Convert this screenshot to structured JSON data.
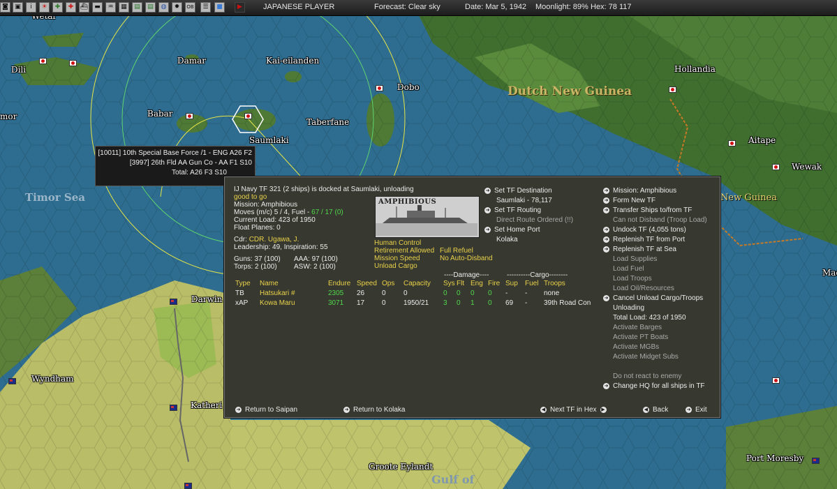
{
  "topbar": {
    "player": "JAPANESE PLAYER",
    "forecast": "Forecast: Clear sky",
    "date": "Date: Mar 5, 1942",
    "moonlight": "Moonlight: 89%",
    "hex": "Hex: 78 117",
    "buttons": [
      "map-icon",
      "disk-icon",
      "info-icon",
      "rising-sun-icon",
      "plane-icon",
      "red-plane-icon",
      "ship-icon",
      "sub-icon",
      "hq-icon",
      "base-icon",
      "report-icon",
      "globe-icon",
      "gear-icon",
      "ob-icon",
      "list-icon",
      "sky-icon",
      "play-icon"
    ],
    "button_glyphs": [
      "◙",
      "▣",
      "i",
      "☀",
      "✚",
      "✚",
      "⛴",
      "▬",
      "♒",
      "▦",
      "▤",
      "◍",
      "✹",
      "OB",
      "☰",
      "■",
      "▶"
    ]
  },
  "map_labels": {
    "wetar": "Wetar",
    "dili": "Dili",
    "timor_partial": "mor",
    "damar": "Damar",
    "kai": "Kai-eilanden",
    "hollandia": "Hollandia",
    "dobo": "Dobo",
    "dutch_ng": "Dutch New Guinea",
    "babar": "Babar",
    "taberfane": "Taberfane",
    "saumlaki": "Saumlaki",
    "aitape": "Aitape",
    "wewak": "Wewak",
    "timor_sea": "Timor Sea",
    "new_guinea": "New Guinea",
    "darwin": "Darwin",
    "wyndham": "Wyndham",
    "katherine": "Katheri",
    "groote": "Groote Eylandt",
    "gulf": "Gulf of",
    "port_moresby": "Port Moresby",
    "mac": "Mac"
  },
  "tooltip": {
    "line1": "[10011] 10th Special Base Force /1 - ENG   A26  F2",
    "line2": "[3997] 26th Fld AA Gun Co - AA   F1  S10",
    "line3": "Total:  A26  F3  S10"
  },
  "panel": {
    "header": "IJ Navy TF 321 (2 ships) is docked at Saumlaki, unloading",
    "status": "good to go",
    "mission": "Mission: Amphibious",
    "moves_prefix": "Moves (m/c)  5 / 4, Fuel - ",
    "fuel": "67 / 17 (0)",
    "current_load": "Current Load:  423 of 1950",
    "float_planes": "Float Planes: 0",
    "cdr_label": "Cdr:",
    "cdr_name": "CDR. Ugawa, J.",
    "leadership": "Leadership: 49, Inspiration: 55",
    "guns": "Guns: 37 (100)",
    "aaa": "AAA: 97 (100)",
    "torps": "Torps: 2 (100)",
    "asw": "ASW: 2 (100)",
    "photo_title": "AMPHIBIOUS",
    "human_control": "Human Control",
    "retirement": "Retirement Allowed",
    "full_refuel": "Full Refuel",
    "mission_speed": "Mission Speed",
    "no_auto_disband": "No Auto-Disband",
    "unload_cargo": "Unload Cargo",
    "set_dest": "Set TF Destination",
    "dest_value": "Saumlaki - 78,117",
    "set_routing": "Set TF Routing",
    "direct_route": "Direct Route Ordered (!!)",
    "set_home": "Set Home Port",
    "home_value": "Kolaka",
    "right_menu": [
      {
        "label": "Mission: Amphibious",
        "arrow": true,
        "dim": false
      },
      {
        "label": "Form New TF",
        "arrow": true,
        "dim": false
      },
      {
        "label": "Transfer Ships to/from TF",
        "arrow": true,
        "dim": false
      },
      {
        "label": "Can not Disband (Troop Load)",
        "arrow": false,
        "dim": true
      },
      {
        "label": "Undock TF (4,055 tons)",
        "arrow": true,
        "dim": false
      },
      {
        "label": "Replenish TF from Port",
        "arrow": true,
        "dim": false
      },
      {
        "label": "Replenish TF at Sea",
        "arrow": true,
        "dim": false
      },
      {
        "label": "Load Supplies",
        "arrow": false,
        "dim": true
      },
      {
        "label": "Load Fuel",
        "arrow": false,
        "dim": true
      },
      {
        "label": "Load Troops",
        "arrow": false,
        "dim": true
      },
      {
        "label": "Load Oil/Resources",
        "arrow": false,
        "dim": true
      },
      {
        "label": "Cancel Unload Cargo/Troops",
        "arrow": true,
        "dim": false
      },
      {
        "label": "Unloading",
        "arrow": false,
        "dim": false
      },
      {
        "label": "Total Load: 423 of 1950",
        "arrow": false,
        "dim": false
      },
      {
        "label": "Activate Barges",
        "arrow": false,
        "dim": true
      },
      {
        "label": "Activate PT Boats",
        "arrow": false,
        "dim": true
      },
      {
        "label": "Activate MGBs",
        "arrow": false,
        "dim": true
      },
      {
        "label": "Activate Midget Subs",
        "arrow": false,
        "dim": true
      },
      {
        "label": "",
        "arrow": false,
        "dim": false
      },
      {
        "label": "Do not react to enemy",
        "arrow": false,
        "dim": true
      },
      {
        "label": "Change HQ for all ships in TF",
        "arrow": true,
        "dim": false
      }
    ],
    "group_damage": "----Damage----",
    "group_cargo": "----------Cargo--------",
    "columns": [
      "Type",
      "Name",
      "Endure",
      "Speed",
      "Ops",
      "Capacity",
      "Sys",
      "Flt",
      "Eng",
      "Fire",
      "Sup",
      "Fuel",
      "Troops"
    ],
    "rows": [
      [
        "TB",
        "Hatsukari #",
        "2305",
        "26",
        "0",
        "0",
        "0",
        "0",
        "0",
        "0",
        "-",
        "-",
        "none"
      ],
      [
        "xAP",
        "Kowa Maru",
        "3071",
        "17",
        "0",
        "1950/21",
        "3",
        "0",
        "1",
        "0",
        "69",
        "-",
        "39th Road Con"
      ]
    ],
    "footer": {
      "return_saipan": "Return to Saipan",
      "return_kolaka": "Return to Kolaka",
      "next_tf": "Next TF in Hex",
      "back": "Back",
      "exit": "Exit"
    }
  }
}
